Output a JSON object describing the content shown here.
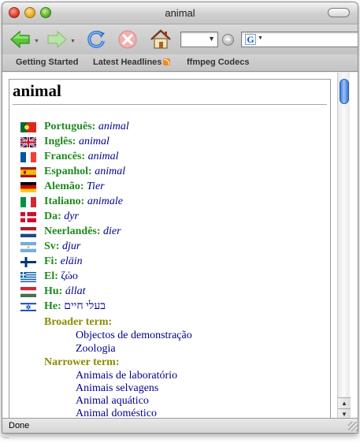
{
  "window": {
    "title": "animal"
  },
  "toolbar": {
    "back_icon": "back-arrow-icon",
    "forward_icon": "forward-arrow-icon",
    "reload_icon": "reload-icon",
    "stop_icon": "stop-icon",
    "home_icon": "home-icon",
    "url_value": "",
    "search_value": "",
    "search_engine_icon": "G"
  },
  "bookmarks": [
    {
      "label": "Getting Started"
    },
    {
      "label": "Latest Headlines"
    },
    {
      "label": "ffmpeg Codecs"
    }
  ],
  "page": {
    "heading": "animal",
    "translations": [
      {
        "lang": "Português:",
        "term": "animal",
        "flag": "pt"
      },
      {
        "lang": "Inglês:",
        "term": "animal",
        "flag": "gb"
      },
      {
        "lang": "Francês:",
        "term": "animal",
        "flag": "fr"
      },
      {
        "lang": "Espanhol:",
        "term": "animal",
        "flag": "es"
      },
      {
        "lang": "Alemão:",
        "term": "Tier",
        "flag": "de"
      },
      {
        "lang": "Italiano:",
        "term": "animale",
        "flag": "it"
      },
      {
        "lang": "Da:",
        "term": "dyr",
        "flag": "dk"
      },
      {
        "lang": "Neerlandês:",
        "term": "dier",
        "flag": "nl"
      },
      {
        "lang": "Sv:",
        "term": "djur",
        "flag": "ar"
      },
      {
        "lang": "Fi:",
        "term": "eläin",
        "flag": "fi"
      },
      {
        "lang": "El:",
        "term": "ζώο",
        "flag": "gr"
      },
      {
        "lang": "Hu:",
        "term": "állat",
        "flag": "hu"
      },
      {
        "lang": "He:",
        "term": "בעלי חיים",
        "flag": "il"
      }
    ],
    "broader_label": "Broader term:",
    "broader_terms": [
      "Objectos de demonstração",
      "Zoologia"
    ],
    "narrower_label": "Narrower term:",
    "narrower_terms": [
      "Animais de laboratório",
      "Animais selvagens",
      "Animal aquático",
      "Animal doméstico"
    ]
  },
  "status": {
    "text": "Done"
  }
}
